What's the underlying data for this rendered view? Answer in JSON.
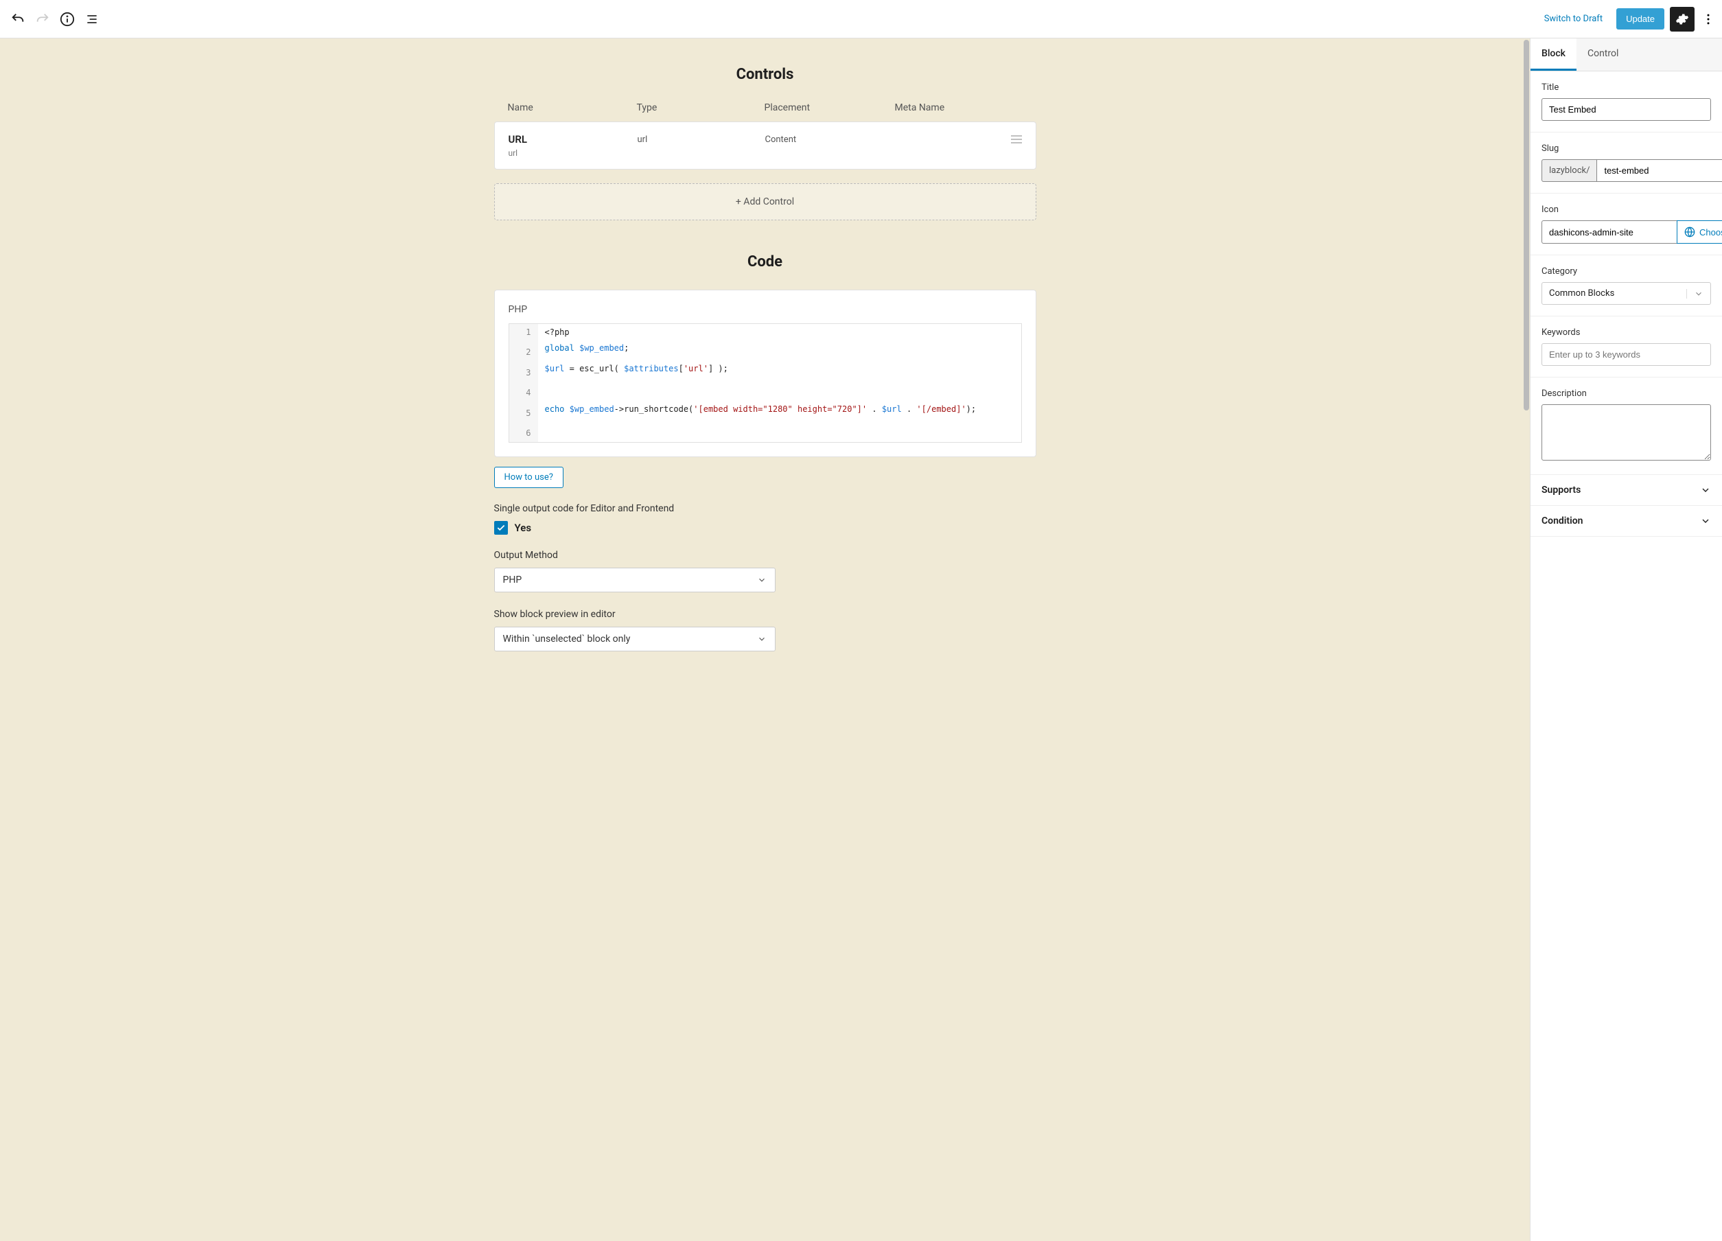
{
  "toolbar": {
    "switch_draft": "Switch to Draft",
    "update": "Update"
  },
  "main": {
    "controls_title": "Controls",
    "headers": {
      "name": "Name",
      "type": "Type",
      "placement": "Placement",
      "meta": "Meta Name"
    },
    "control_row": {
      "title": "URL",
      "sub": "url",
      "type": "url",
      "placement": "Content"
    },
    "add_control": "+ Add Control",
    "code_title": "Code",
    "code_label": "PHP",
    "code_lines": [
      "1",
      "2",
      "3",
      "4",
      "5",
      "6"
    ],
    "howto": "How to use?",
    "single_output_label": "Single output code for Editor and Frontend",
    "yes": "Yes",
    "output_method_label": "Output Method",
    "output_method_value": "PHP",
    "preview_label": "Show block preview in editor",
    "preview_value": "Within `unselected` block only"
  },
  "sidebar": {
    "tab_block": "Block",
    "tab_control": "Control",
    "title_label": "Title",
    "title_value": "Test Embed",
    "slug_label": "Slug",
    "slug_prefix": "lazyblock/",
    "slug_value": "test-embed",
    "icon_label": "Icon",
    "icon_value": "dashicons-admin-site",
    "choose": "Choose",
    "category_label": "Category",
    "category_value": "Common Blocks",
    "keywords_label": "Keywords",
    "keywords_placeholder": "Enter up to 3 keywords",
    "description_label": "Description",
    "supports": "Supports",
    "condition": "Condition"
  }
}
